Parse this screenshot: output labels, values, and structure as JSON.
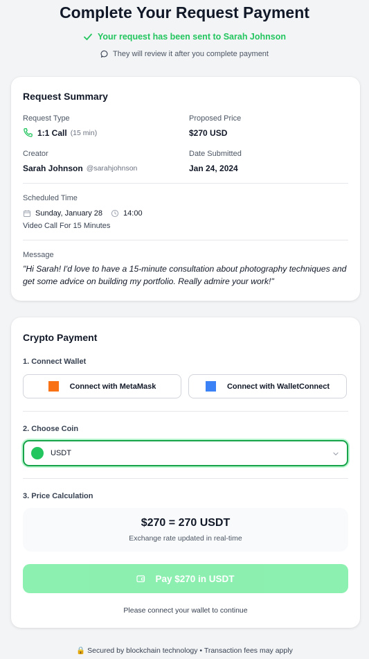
{
  "header": {
    "title": "Complete Your Request Payment",
    "sent_message": "Your request has been sent to Sarah Johnson",
    "review_message": "They will review it after you complete payment"
  },
  "summary": {
    "title": "Request Summary",
    "request_type_label": "Request Type",
    "request_type_value": "1:1 Call",
    "request_type_duration": "(15 min)",
    "proposed_price_label": "Proposed Price",
    "proposed_price_value": "$270 USD",
    "creator_label": "Creator",
    "creator_name": "Sarah Johnson",
    "creator_handle": "@sarahjohnson",
    "date_submitted_label": "Date Submitted",
    "date_submitted_value": "Jan 24, 2024",
    "scheduled_label": "Scheduled Time",
    "scheduled_date": "Sunday, January 28",
    "scheduled_time": "14:00",
    "scheduled_note": "Video Call For 15 Minutes",
    "message_label": "Message",
    "message_text": "\"Hi Sarah! I'd love to have a 15-minute consultation about photography techniques and get some advice on building my portfolio. Really admire your work!\""
  },
  "payment": {
    "title": "Crypto Payment",
    "step1_label": "1. Connect Wallet",
    "metamask_label": "Connect with MetaMask",
    "walletconnect_label": "Connect with WalletConnect",
    "step2_label": "2. Choose Coin",
    "selected_coin": "USDT",
    "step3_label": "3. Price Calculation",
    "calc_main": "$270 = 270 USDT",
    "calc_sub": "Exchange rate updated in real-time",
    "pay_button_label": "Pay $270 in USDT",
    "connect_note": "Please connect your wallet to continue"
  },
  "footer": {
    "text": "🔒 Secured by blockchain technology • Transaction fees may apply"
  },
  "colors": {
    "accent_green": "#22c55e",
    "metamask": "#f97316",
    "walletconnect": "#3b82f6",
    "pay_button_disabled": "#86efac"
  },
  "icons": {
    "sent": "check-icon",
    "review": "chat-bubble-icon",
    "request_type": "phone-icon",
    "scheduled_date": "calendar-icon",
    "scheduled_time": "clock-icon",
    "coin_select": "chevron-down-icon",
    "pay": "wallet-icon"
  }
}
